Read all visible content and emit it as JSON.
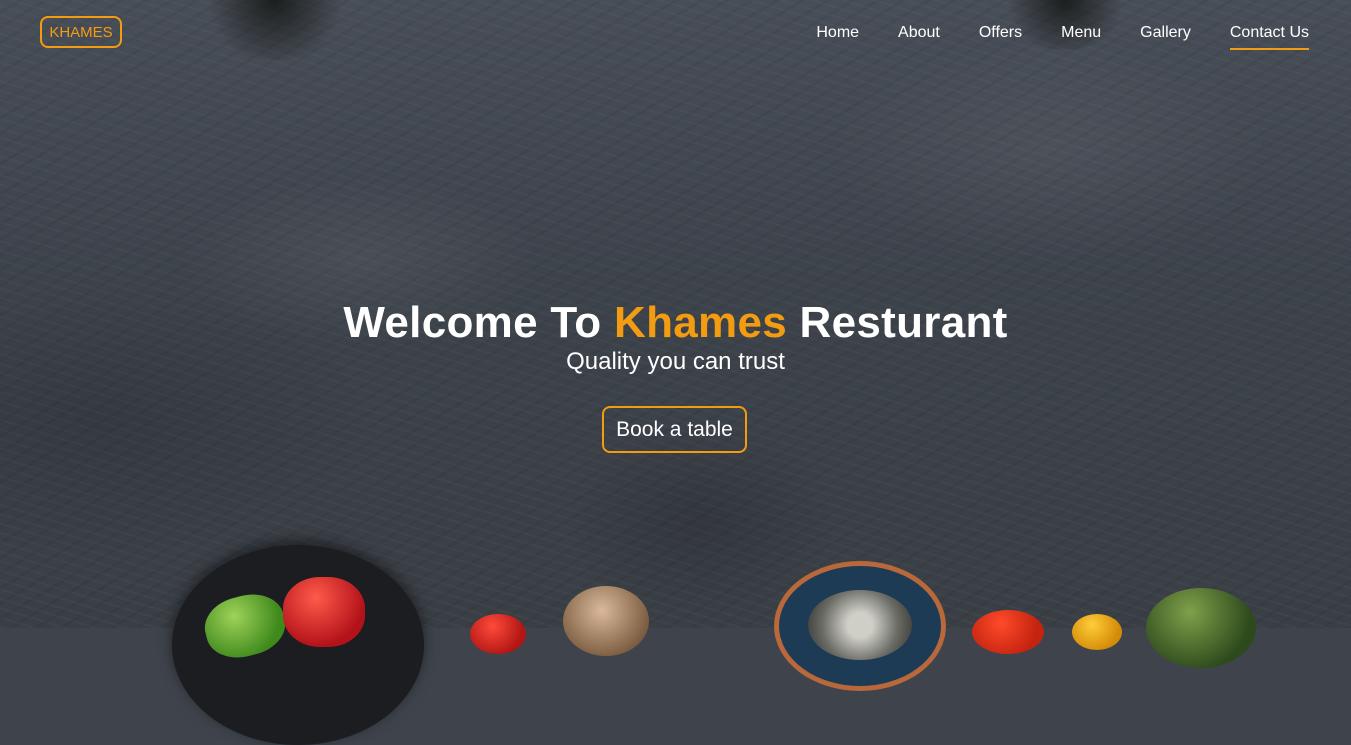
{
  "nav": {
    "logo": "KHAMES",
    "links": [
      {
        "label": "Home"
      },
      {
        "label": "About"
      },
      {
        "label": "Offers"
      },
      {
        "label": "Menu"
      },
      {
        "label": "Gallery"
      },
      {
        "label": "Contact Us",
        "active": true
      }
    ]
  },
  "hero": {
    "title_prefix": "Welcome To",
    "title_brand": "Khames",
    "title_suffix": "Resturant",
    "subtitle": "Quality you can trust",
    "cta_label": "Book a table"
  },
  "colors": {
    "accent": "#f39c12",
    "text": "#ffffff",
    "background": "#3f444c"
  }
}
